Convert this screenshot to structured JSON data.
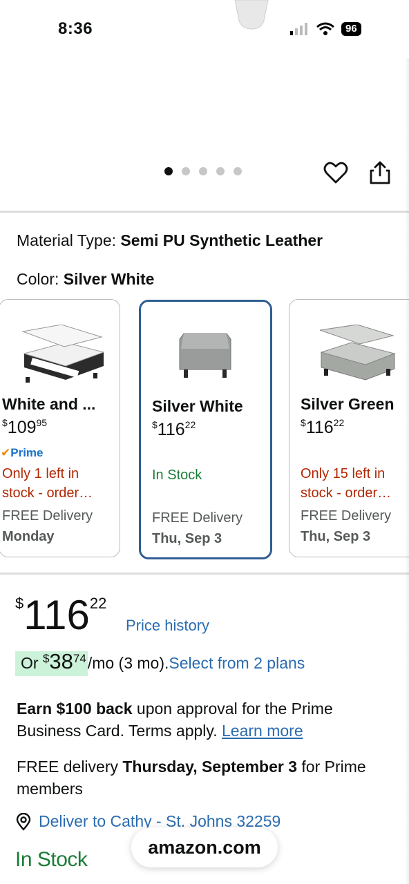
{
  "status_bar": {
    "time": "8:36",
    "battery": "96"
  },
  "gallery": {
    "dots": 5,
    "active_index": 0
  },
  "attributes": {
    "material_label": "Material Type:",
    "material_value": "Semi PU Synthetic Leather",
    "color_label": "Color:",
    "color_value": "Silver White"
  },
  "swatches": [
    {
      "title": "White and ...",
      "price_currency": "$",
      "price_whole": "109",
      "price_fraction": "95",
      "prime_label": "Prime",
      "stock_text": "Only 1 left in stock - order...",
      "stock_line1": "Only 1 left in",
      "stock_line2": "stock - order…",
      "delivery_label": "FREE Delivery",
      "delivery_day": "Monday"
    },
    {
      "title": "Silver White",
      "price_currency": "$",
      "price_whole": "116",
      "price_fraction": "22",
      "stock_text": "In Stock",
      "delivery_label": "FREE Delivery",
      "delivery_day": "Thu, Sep 3"
    },
    {
      "title": "Silver Green",
      "price_currency": "$",
      "price_whole": "116",
      "price_fraction": "22",
      "stock_line1": "Only 15 left in",
      "stock_line2": "stock - order…",
      "delivery_label": "FREE Delivery",
      "delivery_day": "Thu, Sep 3"
    }
  ],
  "price": {
    "currency": "$",
    "whole": "116",
    "fraction": "22",
    "history_link": "Price history"
  },
  "installment": {
    "prefix": "Or ",
    "currency": "$",
    "whole": "38",
    "fraction": "74",
    "suffix": "/mo (3 mo).",
    "link": "Select from 2 plans"
  },
  "promo": {
    "bold": "Earn $100 back",
    "text": " upon approval for the Prime Business Card. Terms apply. ",
    "link": "Learn more"
  },
  "delivery": {
    "prefix": "FREE delivery ",
    "date": "Thursday, September 3",
    "suffix": " for Prime members"
  },
  "deliver_to": "Deliver to Cathy - St. Johns 32259",
  "stock_status": "In Stock",
  "url": "amazon.com",
  "colors": {
    "link_blue": "#2a6bb0",
    "stock_green": "#1a7d37",
    "stock_red": "#b12704",
    "selected_border": "#2f5e94",
    "installment_bg": "#cdf2da"
  }
}
